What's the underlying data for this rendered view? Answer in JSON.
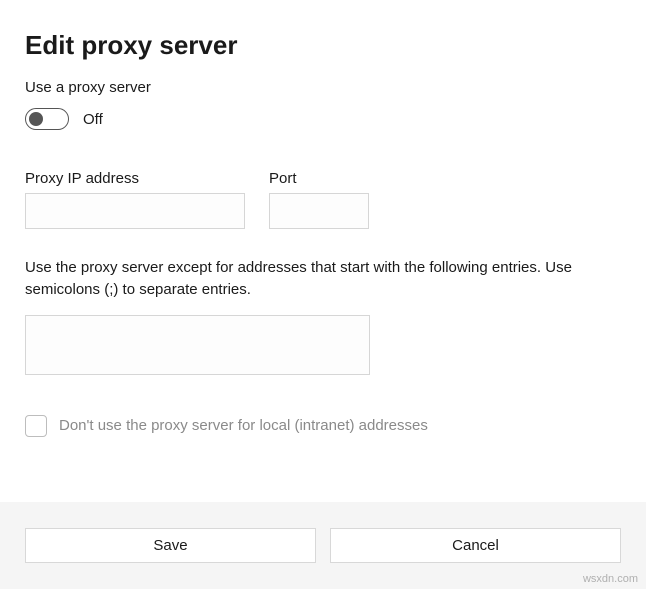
{
  "title": "Edit proxy server",
  "useProxyLabel": "Use a proxy server",
  "toggle": {
    "state": "Off",
    "on": false
  },
  "fields": {
    "ipLabel": "Proxy IP address",
    "ipValue": "",
    "portLabel": "Port",
    "portValue": ""
  },
  "exceptionsDesc": "Use the proxy server except for addresses that start with the following entries. Use semicolons (;) to separate entries.",
  "exceptionsValue": "",
  "localCheckbox": {
    "checked": false,
    "label": "Don't use the proxy server for local (intranet) addresses"
  },
  "buttons": {
    "save": "Save",
    "cancel": "Cancel"
  },
  "watermark": "wsxdn.com"
}
